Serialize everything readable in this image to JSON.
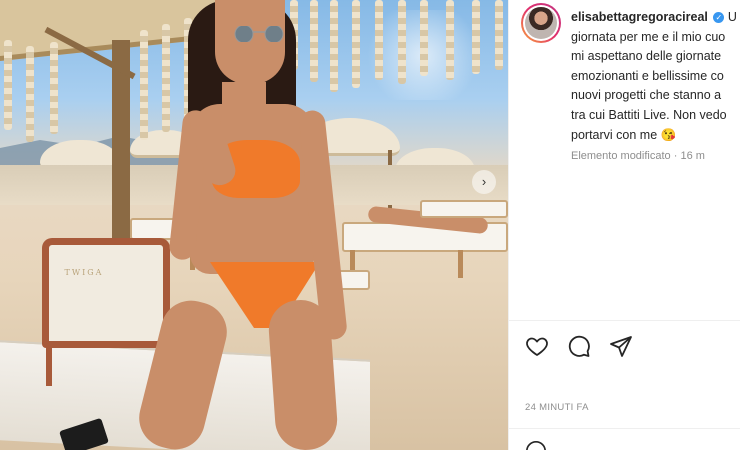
{
  "post": {
    "username": "elisabettagregoracireal",
    "caption_lines": [
      "giornata per me e il mio cuo",
      "mi aspettano delle giornate",
      "emozionanti e bellissime co",
      "nuovi progetti che stanno a",
      "tra cui Battiti Live. Non vedo",
      "portarvi con me"
    ],
    "caption_first_fragment": "U",
    "caption_emoji": "😘",
    "edited_label": "Elemento modificato",
    "edited_sep": " · ",
    "edited_time": "16 m",
    "timestamp": "24 MINUTI FA"
  },
  "photo": {
    "chair_brand": "TWIGA"
  },
  "icons": {
    "like": "heart-icon",
    "comment": "comment-icon",
    "share": "share-icon",
    "verified": "verified-badge-icon",
    "next": "chevron-right-icon",
    "emoji": "emoji-icon"
  },
  "colors": {
    "bikini": "#f07a2a",
    "verified": "#3897f0",
    "muted_text": "#8e8e8e"
  }
}
